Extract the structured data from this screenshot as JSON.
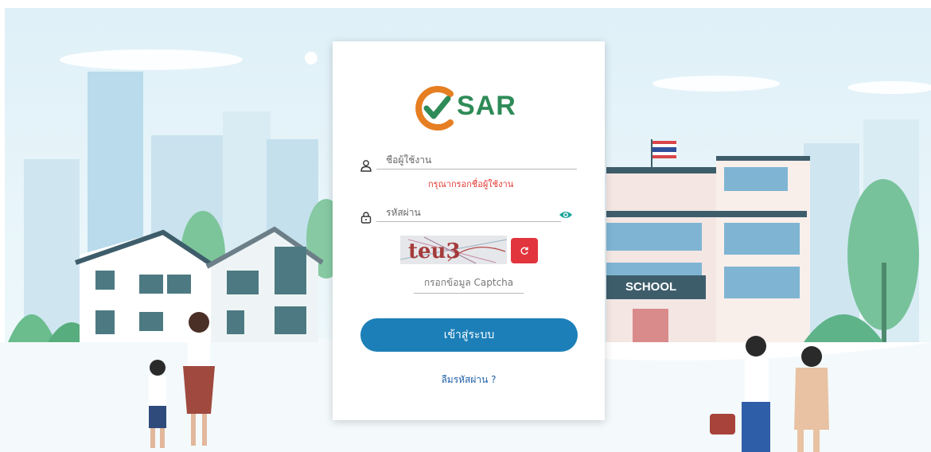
{
  "brand": {
    "logo_text": "SAR",
    "logo_letter_color": "#e67e22",
    "check_color": "#2e8b57"
  },
  "login": {
    "username_placeholder": "ชื่อผู้ใช้งาน",
    "username_error": "กรุณากรอกชื่อผู้ใช้งาน",
    "password_placeholder": "รหัสผ่าน",
    "captcha_text": "teu3",
    "refresh_icon": "refresh-icon",
    "captcha_placeholder": "กรอกข้อมูล Captcha",
    "submit_label": "เข้าสู่ระบบ",
    "forgot_password_label": "ลืมรหัสผ่าน ?"
  },
  "background": {
    "school_sign": "SCHOOL"
  },
  "colors": {
    "primary": "#1c7fb8",
    "error": "#e53935",
    "refresh": "#e2343d",
    "eye_icon": "#1aa39a"
  }
}
